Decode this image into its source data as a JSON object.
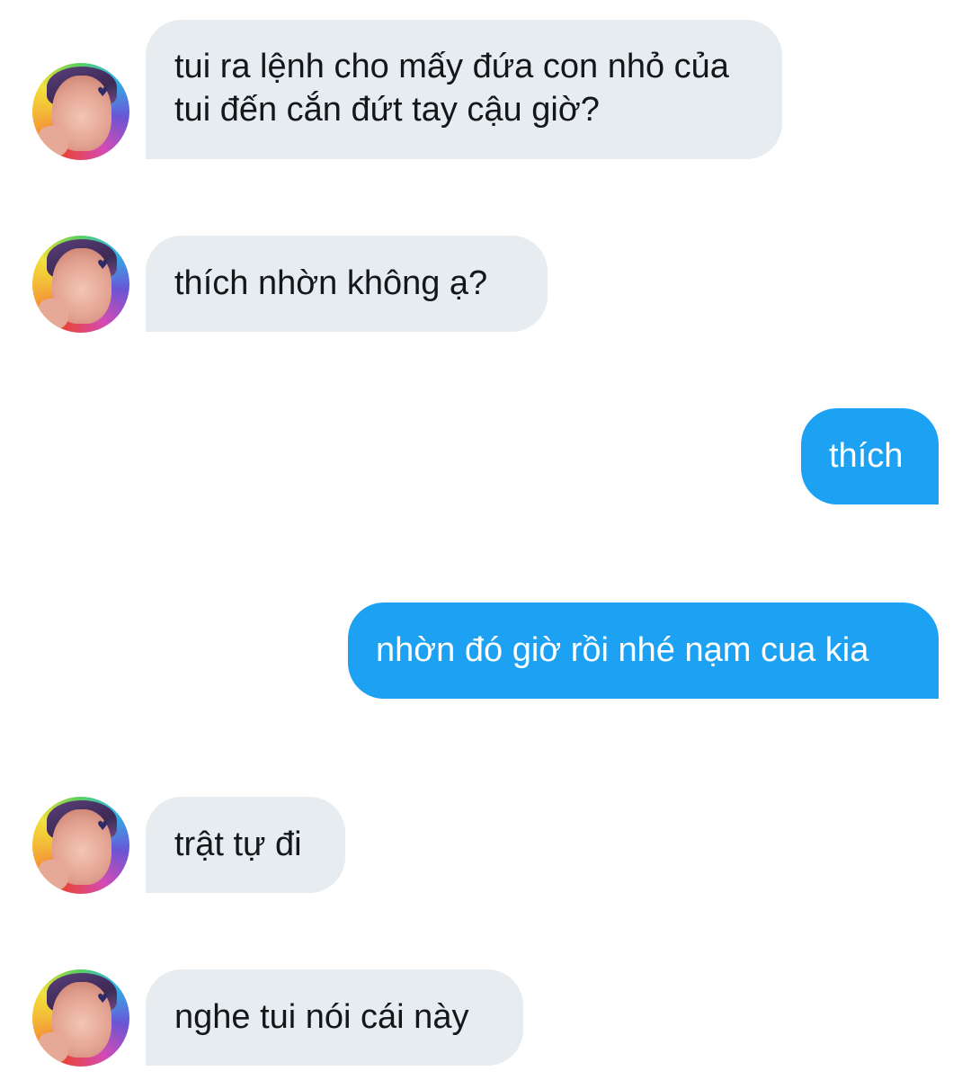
{
  "conversation": {
    "messages": [
      {
        "direction": "incoming",
        "text": "tui ra lệnh cho mấy đứa con nhỏ của tui đến cắn đứt tay cậu giờ?",
        "avatar": "profile-avatar"
      },
      {
        "direction": "incoming",
        "text": "thích nhờn không ạ?",
        "avatar": "profile-avatar"
      },
      {
        "direction": "outgoing",
        "text": "thích"
      },
      {
        "direction": "outgoing",
        "text": "nhờn đó giờ rồi nhé nạm cua kia"
      },
      {
        "direction": "incoming",
        "text": "trật tự đi",
        "avatar": "profile-avatar"
      },
      {
        "direction": "incoming",
        "text": "nghe tui nói cái này",
        "avatar": "profile-avatar"
      }
    ]
  },
  "colors": {
    "incoming_bubble": "#e6ecf0",
    "outgoing_bubble": "#1da1f2",
    "incoming_text": "#14171a",
    "outgoing_text": "#ffffff",
    "background": "#ffffff"
  }
}
